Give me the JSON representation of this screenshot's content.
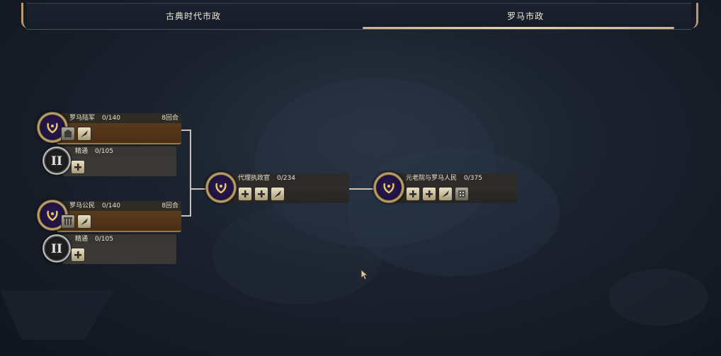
{
  "tabs": [
    {
      "label": "古典时代市政",
      "active": false
    },
    {
      "label": "罗马市政",
      "active": true
    }
  ],
  "nodes": {
    "legion": {
      "name": "罗马陆军",
      "progress": "0/140",
      "turns": "8回合"
    },
    "mastery1": {
      "name": "精通",
      "progress": "0/105",
      "roman": "II"
    },
    "citizens": {
      "name": "罗马公民",
      "progress": "0/140",
      "turns": "8回合"
    },
    "mastery2": {
      "name": "精通",
      "progress": "0/105",
      "roman": "II"
    },
    "consul": {
      "name": "代理执政官",
      "progress": "0/234"
    },
    "senate": {
      "name": "元老院与罗马人民",
      "progress": "0/375"
    }
  },
  "colors": {
    "accent_gold": "#c9b48a",
    "active_node": "#5a3a1c",
    "portrait_purple": "#2a1a56"
  },
  "icons": {
    "portrait": "laurel-wreath-icon",
    "unlock_plus": "plus-icon",
    "unlock_quill": "quill-icon",
    "unlock_building": "building-icon"
  }
}
